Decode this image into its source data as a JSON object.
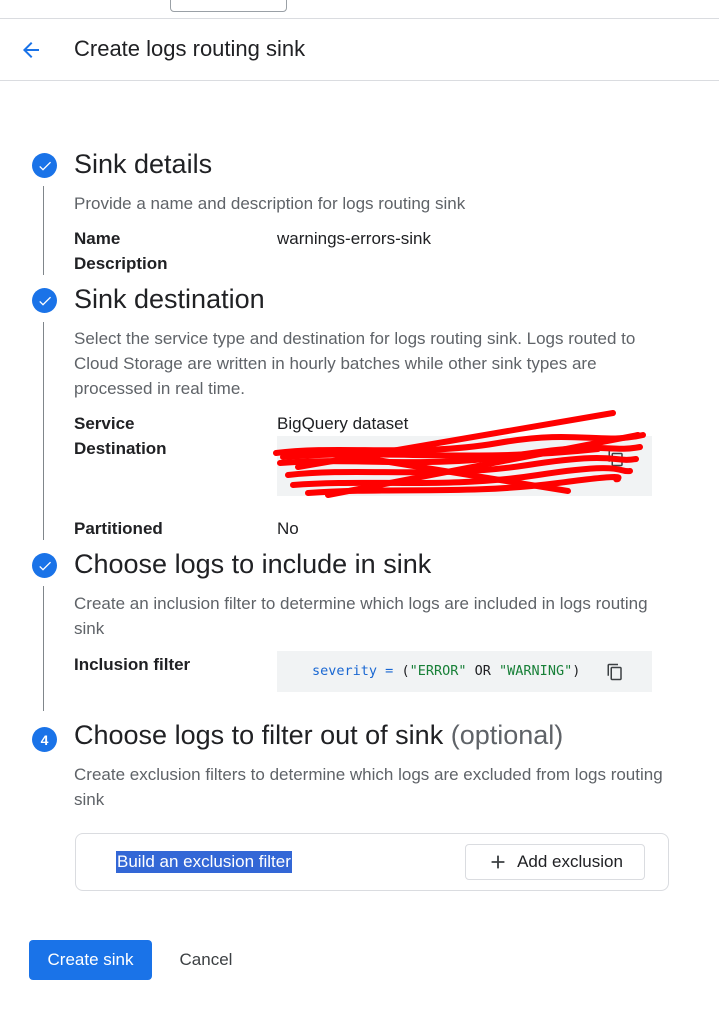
{
  "header": {
    "title": "Create logs routing sink",
    "back_icon": "arrow-back-icon"
  },
  "colors": {
    "accent": "#1a73e8",
    "selection": "#3367d6",
    "redaction": "#ff0000",
    "code_bg": "#f1f3f4"
  },
  "steps": [
    {
      "state": "completed",
      "title": "Sink details",
      "description": "Provide a name and description for logs routing sink",
      "fields": [
        {
          "label": "Name",
          "value": "warnings-errors-sink"
        },
        {
          "label": "Description",
          "value": ""
        }
      ]
    },
    {
      "state": "completed",
      "title": "Sink destination",
      "description": "Select the service type and destination for logs routing sink. Logs routed to Cloud Storage are written in hourly batches while other sink types are processed in real time.",
      "fields": [
        {
          "label": "Service",
          "value": "BigQuery dataset"
        },
        {
          "label": "Destination",
          "value": ""
        },
        {
          "label": "Partitioned",
          "value": "No"
        }
      ]
    },
    {
      "state": "completed",
      "title": "Choose logs to include in sink",
      "description": "Create an inclusion filter to determine which logs are included in logs routing sink",
      "fields": [
        {
          "label": "Inclusion filter"
        }
      ],
      "filter": {
        "key": "severity",
        "op": "=",
        "open": "(",
        "v1": "\"ERROR\"",
        "or": "OR",
        "v2": "\"WARNING\"",
        "close": ")"
      }
    },
    {
      "state": "current",
      "number": "4",
      "title": "Choose logs to filter out of sink",
      "optional": "(optional)",
      "description": "Create exclusion filters to determine which logs are excluded from logs routing sink",
      "exclusion_label": "Build an exclusion filter",
      "add_button": "Add exclusion"
    }
  ],
  "actions": {
    "create": "Create sink",
    "cancel": "Cancel"
  }
}
